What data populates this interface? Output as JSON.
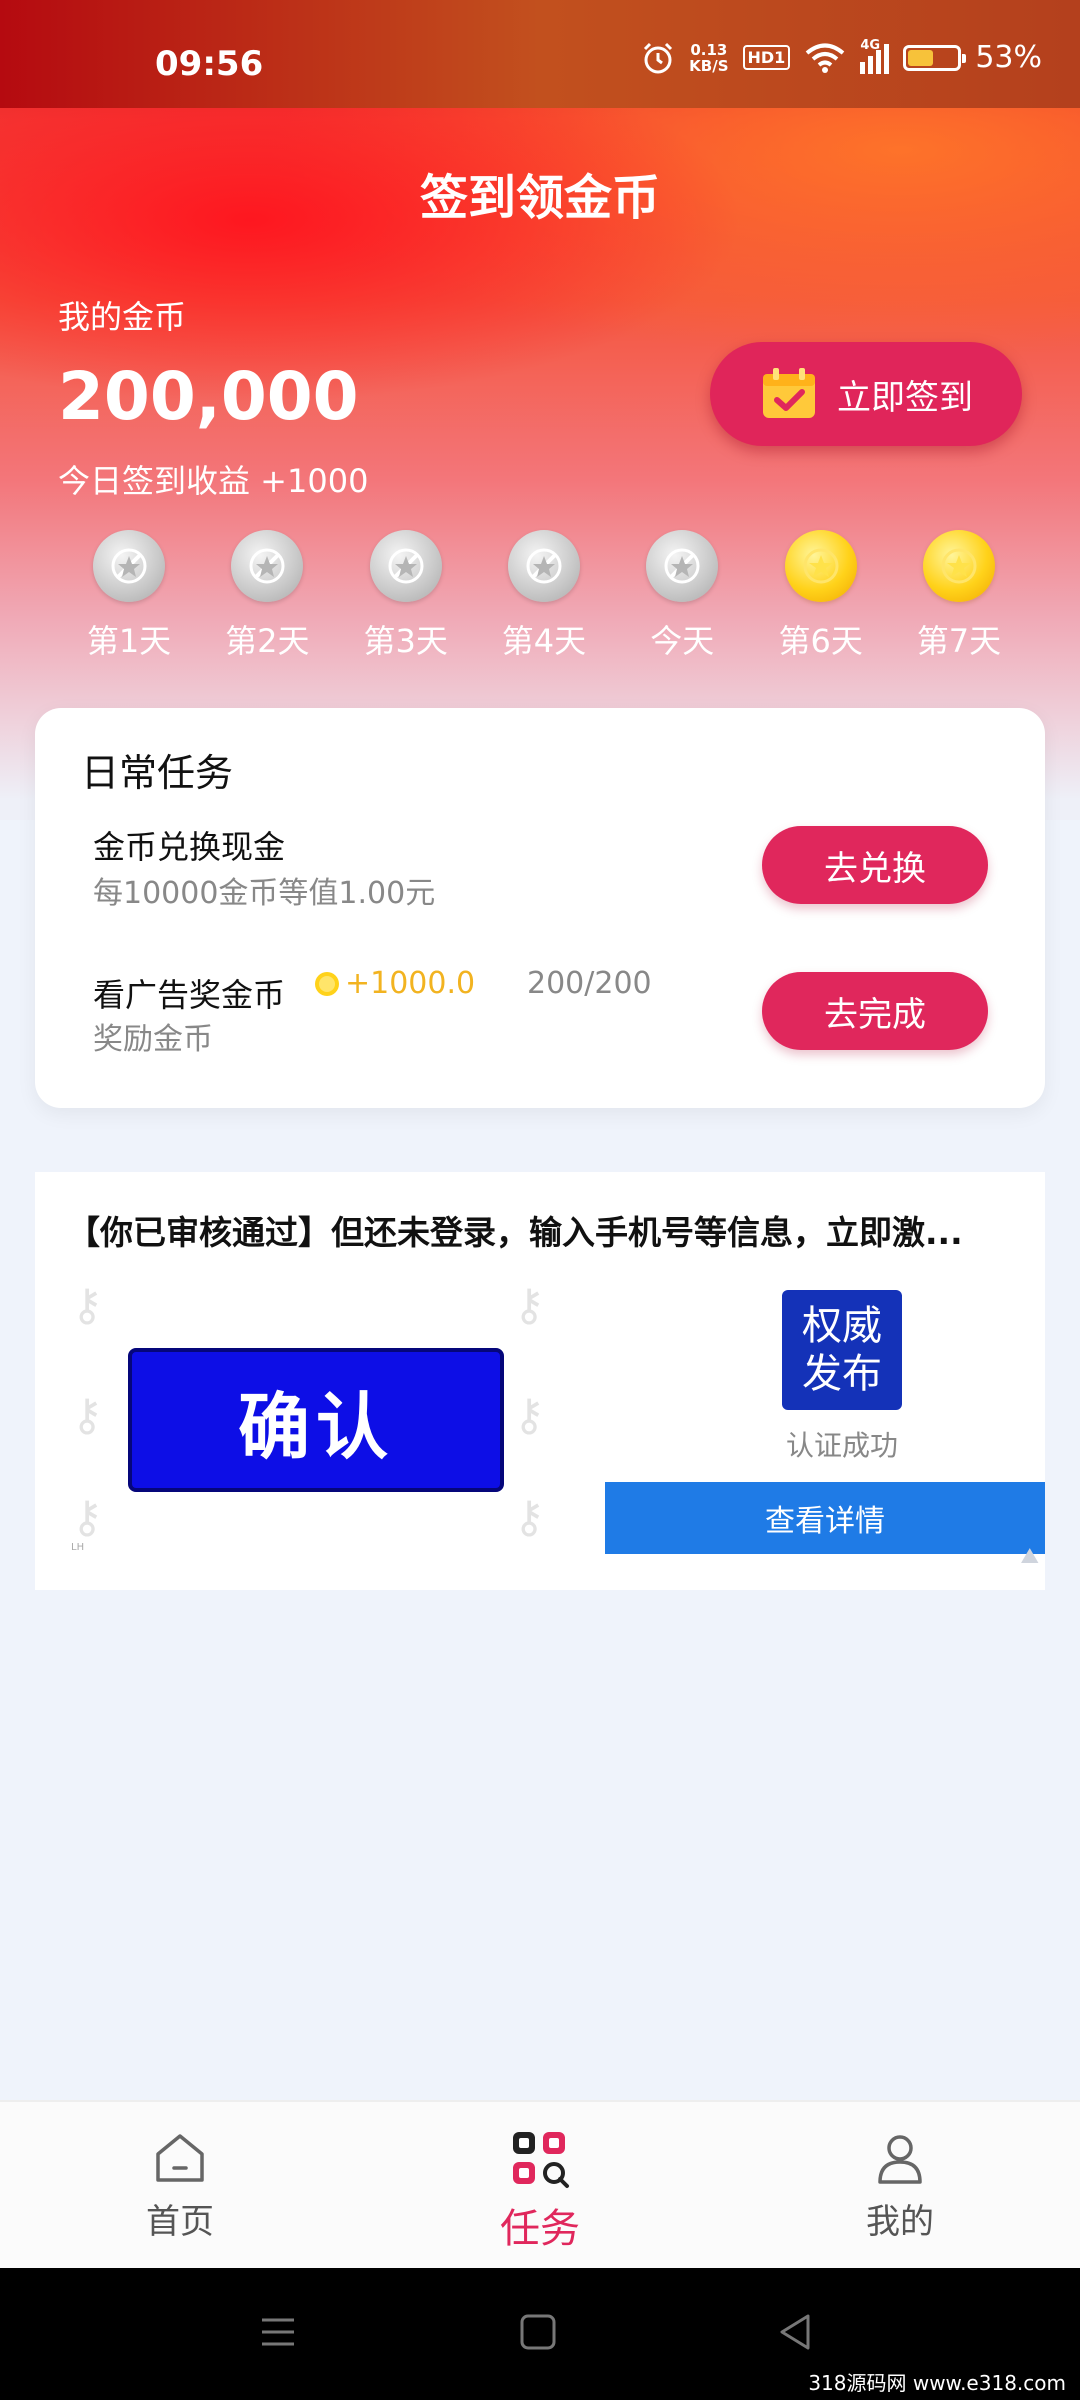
{
  "status_bar": {
    "time": "09:56",
    "net_speed_value": "0.13",
    "net_speed_unit": "KB/S",
    "hd_label": "HD1",
    "signal_label": "4G",
    "battery_percent": "53%",
    "battery_level": 0.53
  },
  "header": {
    "title": "签到领金币",
    "coins_label": "我的金币",
    "coins_value": "200,000",
    "today_gain": "今日签到收益 +1000",
    "signin_button": "立即签到"
  },
  "days": [
    {
      "label": "第1天",
      "state": "claimed"
    },
    {
      "label": "第2天",
      "state": "claimed"
    },
    {
      "label": "第3天",
      "state": "claimed"
    },
    {
      "label": "第4天",
      "state": "claimed"
    },
    {
      "label": "今天",
      "state": "claimed"
    },
    {
      "label": "第6天",
      "state": "pending"
    },
    {
      "label": "第7天",
      "state": "pending"
    }
  ],
  "daily_tasks": {
    "title": "日常任务",
    "items": [
      {
        "name": "金币兑换现金",
        "subtitle": "每10000金币等值1.00元",
        "button": "去兑换"
      },
      {
        "name": "看广告奖金币",
        "reward": "+1000.0",
        "progress": "200/200",
        "subtitle": "奖励金币",
        "button": "去完成"
      }
    ]
  },
  "ad": {
    "headline": "【你已审核通过】但还未登录，输入手机号等信息，立即激...",
    "confirm": "确认",
    "badge_line1": "权威",
    "badge_line2": "发布",
    "auth_text": "认证成功",
    "detail_button": "查看详情",
    "tiny_mark": "LH"
  },
  "tabbar": {
    "items": [
      {
        "label": "首页",
        "icon": "home-icon",
        "active": false
      },
      {
        "label": "任务",
        "icon": "tasks-icon",
        "active": true
      },
      {
        "label": "我的",
        "icon": "profile-icon",
        "active": false
      }
    ]
  },
  "watermark": "318源码网 www.e318.com",
  "colors": {
    "accent": "#e0275c",
    "gold": "#f2b320",
    "ad_blue": "#1f7be6"
  }
}
